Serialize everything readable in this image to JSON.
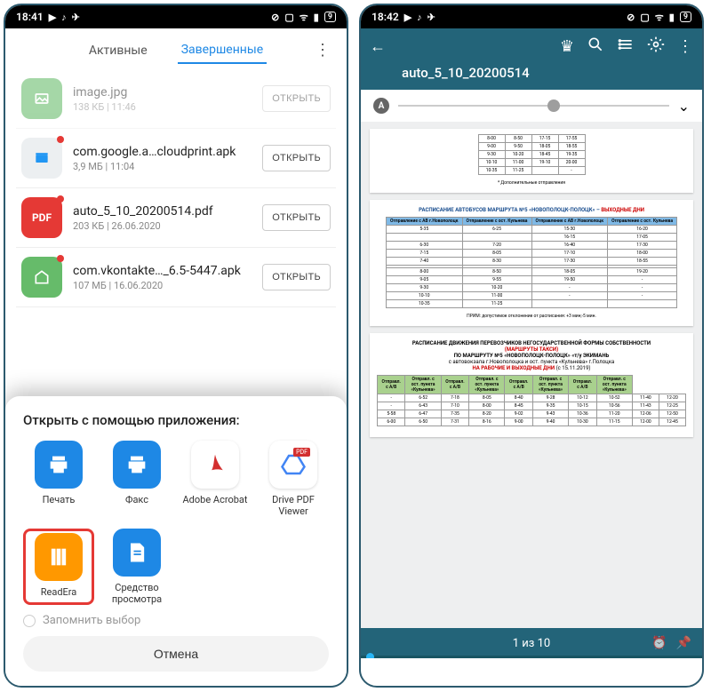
{
  "left": {
    "statusbar": {
      "time": "18:41",
      "right_icons": "⊘ ⊡ ᯤ ⌃9⌃"
    },
    "tabs": {
      "active": "Активные",
      "done": "Завершенные"
    },
    "files": [
      {
        "name": "image.jpg",
        "meta": "138 КБ | 11:46",
        "btn": "ОТКРЫТЬ",
        "icon": "img"
      },
      {
        "name": "com.google.a…cloudprint.apk",
        "meta": "3,9 МБ | 11:04",
        "btn": "ОТКРЫТЬ",
        "icon": "apk",
        "dot": true
      },
      {
        "name": "auto_5_10_20200514.pdf",
        "meta": "203 КБ | 26.06.2020",
        "btn": "ОТКРЫТЬ",
        "icon": "pdf",
        "dot": true
      },
      {
        "name": "com.vkontakte…_6.5-5447.apk",
        "meta": "107 МБ | 16.06.2020",
        "btn": "ОТКРЫТЬ",
        "icon": "apk2",
        "dot": true
      }
    ],
    "sheet": {
      "title": "Открыть с помощью приложения:",
      "apps": [
        {
          "label": "Печать",
          "icon": "print"
        },
        {
          "label": "Факс",
          "icon": "fax"
        },
        {
          "label": "Adobe Acrobat",
          "icon": "acrobat"
        },
        {
          "label": "Drive PDF Viewer",
          "icon": "drive"
        },
        {
          "label": "ReadEra",
          "icon": "readera",
          "highlight": true
        },
        {
          "label": "Средство просмотра",
          "icon": "viewer"
        }
      ],
      "remember": "Запомнить выбор",
      "cancel": "Отмена"
    }
  },
  "right": {
    "statusbar": {
      "time": "18:42",
      "right_icons": "⊘ ⊡ ᯤ ⌃9⌃"
    },
    "header": {
      "title": "auto_5_10_20200514"
    },
    "page1": {
      "rows": [
        [
          "8-00",
          "8-50",
          "17-15",
          "17-55"
        ],
        [
          "9-00",
          "9-50",
          "18-05",
          "18-55"
        ],
        [
          "9-30",
          "10-20",
          "18-45",
          "19-35"
        ],
        [
          "10-10",
          "11-00",
          "19-10",
          "20-00"
        ],
        [
          "10-35",
          "11-25",
          "",
          "-"
        ]
      ],
      "note": "* Дополнительные отправления"
    },
    "page2": {
      "title_main": "РАСПИСАНИЕ АВТОБУСОВ МАРШРУТА №5 «НОВОПОЛОЦК-ПОЛОЦК» – ",
      "title_red": "ВЫХОДНЫЕ ДНИ",
      "headers": [
        "Отправление с АВ г.Новополоцк",
        "Отправление с ост. Кульнева",
        "Отправление с АВ г.Новополоцк",
        "Отправление с ост. Кульнева"
      ],
      "rows": [
        [
          "5-35",
          "6-25",
          "15-30",
          "16-20"
        ],
        [
          "",
          "",
          "16-15",
          "17-05"
        ],
        [
          "6-30",
          "7-20",
          "16-40",
          "17-30"
        ],
        [
          "7-15",
          "8-05",
          "17-10",
          "18-00"
        ],
        [
          "7-40",
          "8-30",
          "17-30",
          "18-55"
        ],
        [
          "",
          "",
          "",
          ""
        ],
        [
          "8-00",
          "8-50",
          "18-05",
          "19-20"
        ],
        [
          "9-05",
          "9-55",
          "19-50",
          "-"
        ],
        [
          "9-30",
          "10-20",
          "-",
          "-"
        ],
        [
          "10-10",
          "11-00",
          "-",
          "-"
        ],
        [
          "10-35",
          "11-25",
          "",
          ""
        ]
      ],
      "note": "ПРИМ: допустимое отклонение от расписания: +3 мин;-5 мин."
    },
    "page3": {
      "title1": "РАСПИСАНИЕ ДВИЖЕНИЯ ПЕРЕВОЗЧИКОВ НЕГОСУДАРСТВЕННОЙ ФОРМЫ СОБСТВЕННОСТИ",
      "title2": "(МАРШРУТЫ ТАКСИ)",
      "title3": "ПО МАРШРУТУ №5 «НОВОПОЛОЦК-ПОЛОЦК» «т/у ЭКИМАНЬ",
      "title4": "с автовокзала г.Новополоцка и ост. пункта «Кульнева» г.Полоцка",
      "title5_a": "НА РАБОЧИЕ И ВЫХОДНЫЕ ДНИ",
      "title5_b": "(с 15.11.2019)",
      "headers": [
        "Отправл. с А/В",
        "Отправл. с ост. пункта «Кульнева»",
        "Отправл. с А/В",
        "Отправл. с ост. пункта «Кульнева»",
        "Отправл. с А/В",
        "Отправл. с ост. пункта «Кульнева»",
        "Отправл. с А/В",
        "Отправл. с ост. пункта «Кульнева»"
      ],
      "rows": [
        [
          "-",
          "6-52",
          "7-18",
          "8-05",
          "8-40",
          "9-28",
          "10-12",
          "10-52",
          "11-40",
          "12-20"
        ],
        [
          "-",
          "6-43",
          "7-10",
          "8-00",
          "8-45",
          "9-35",
          "10-15",
          "10-56",
          "11-43",
          "12-25"
        ],
        [
          "5-58",
          "6-47",
          "7-35",
          "8-20",
          "9-02",
          "9-43",
          "10-36",
          "11-20",
          "12-06",
          "12-50"
        ],
        [
          "6-00",
          "6-50",
          "7-31",
          "8-16",
          "9-00",
          "9-40",
          "10-30",
          "11-15",
          "12-00",
          "12-45"
        ]
      ]
    },
    "footer": {
      "pager": "1 из 10"
    }
  }
}
